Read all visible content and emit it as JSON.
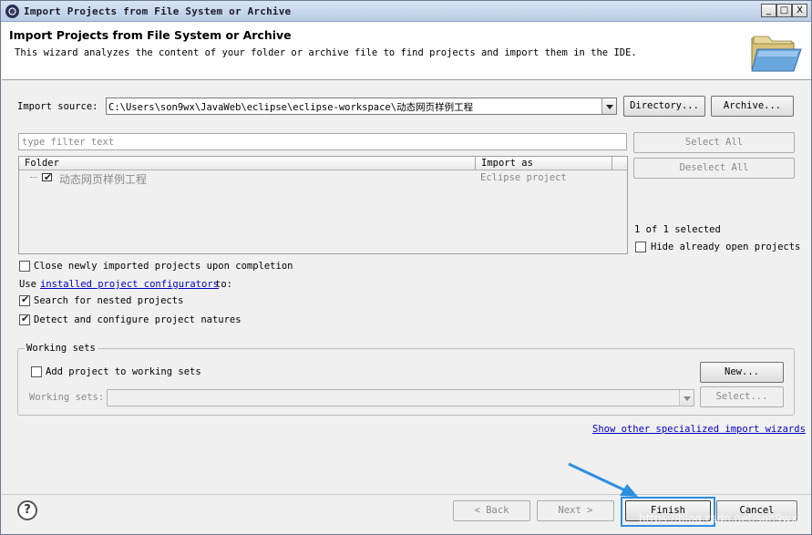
{
  "window": {
    "title": "Import Projects from File System or Archive",
    "controls": {
      "minimize": "_",
      "maximize": "□",
      "close": "X"
    }
  },
  "header": {
    "title": "Import Projects from File System or Archive",
    "description": "This wizard analyzes the content of your folder or archive file to find projects and import them in the IDE.",
    "icon": "folder-open-icon"
  },
  "import_source": {
    "label": "Import source:",
    "value": "C:\\Users\\son9wx\\JavaWeb\\eclipse\\eclipse-workspace\\动态网页样例工程",
    "directory_button": "Directory...",
    "archive_button": "Archive..."
  },
  "filter": {
    "placeholder": "type filter text"
  },
  "table": {
    "columns": [
      "Folder",
      "Import as"
    ],
    "rows": [
      {
        "folder": "动态网页样例工程",
        "import_as": "Eclipse project",
        "checked": true
      }
    ]
  },
  "side": {
    "select_all": "Select All",
    "deselect_all": "Deselect All",
    "selection_status": "1 of 1 selected",
    "hide_open_label": "Hide already open projects",
    "hide_open_checked": false
  },
  "options": {
    "close_imported_label": "Close newly imported projects upon completion",
    "close_imported_checked": false,
    "use_prefix": "Use",
    "configurators_link": "installed project configurators",
    "use_suffix": "to:",
    "search_nested_label": "Search for nested projects",
    "search_nested_checked": true,
    "detect_natures_label": "Detect and configure project natures",
    "detect_natures_checked": true
  },
  "working_sets": {
    "group_title": "Working sets",
    "add_label": "Add project to working sets",
    "add_checked": false,
    "new_button": "New...",
    "sets_label": "Working sets:",
    "sets_value": "",
    "select_button": "Select..."
  },
  "more_wizards_link": "Show other specialized import wizards",
  "footer": {
    "back_button": "< Back",
    "next_button": "Next >",
    "finish_button": "Finish",
    "cancel_button": "Cancel"
  },
  "watermark": "https://blog.csdn.net/son9wx",
  "colors": {
    "link": "#0000c8",
    "highlight": "#2d8fe0",
    "titlebar": "#c8d8ec"
  }
}
